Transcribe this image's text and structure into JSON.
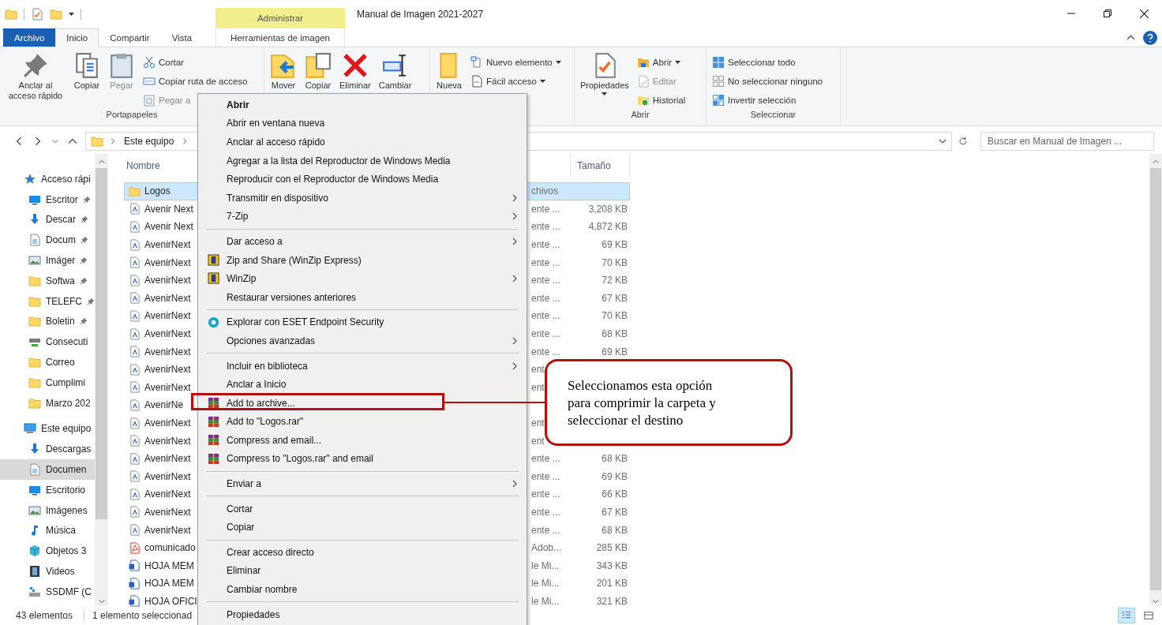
{
  "window": {
    "title": "Manual de Imagen 2021-2027"
  },
  "ribbon_tabs": [
    {
      "label": "Archivo",
      "kind": "file",
      "selected": false
    },
    {
      "label": "Inicio",
      "kind": "tab",
      "selected": true
    },
    {
      "label": "Compartir",
      "kind": "tab",
      "selected": false
    },
    {
      "label": "Vista",
      "kind": "tab",
      "selected": false
    },
    {
      "label": "Herramientas de imagen",
      "kind": "context",
      "header": "Administrar",
      "selected": false
    }
  ],
  "ribbon": {
    "groups": [
      {
        "label": "Portapapeles",
        "large": [
          {
            "label": "Anclar al acceso rápido",
            "kind": "pin",
            "disabled": false,
            "dropdown": false
          },
          {
            "label": "Copiar",
            "kind": "copy",
            "disabled": false,
            "dropdown": false
          },
          {
            "label": "Pegar",
            "kind": "paste",
            "disabled": true,
            "dropdown": false
          }
        ],
        "small": [
          {
            "label": "Cortar",
            "kind": "cut",
            "disabled": false,
            "dropdown": false
          },
          {
            "label": "Copiar ruta de acceso",
            "kind": "path",
            "disabled": false,
            "dropdown": false
          },
          {
            "label": "Pegar a",
            "kind": "paste-shortcut",
            "disabled": true,
            "dropdown": false
          }
        ]
      },
      {
        "large": [
          {
            "label": "Mover",
            "kind": "move",
            "disabled": false,
            "dropdown": false
          },
          {
            "label": "Copiar",
            "kind": "copy-to",
            "disabled": false,
            "dropdown": false
          },
          {
            "label": "Eliminar",
            "kind": "delete",
            "disabled": false,
            "dropdown": false
          },
          {
            "label": "Cambiar",
            "kind": "rename",
            "disabled": false,
            "dropdown": false
          }
        ]
      },
      {
        "large": [
          {
            "label": "Nueva",
            "kind": "new-folder",
            "disabled": false,
            "dropdown": false
          }
        ],
        "small": [
          {
            "label": "Nuevo elemento",
            "kind": "new-item",
            "disabled": false,
            "dropdown": true
          },
          {
            "label": "Fácil acceso",
            "kind": "easy-access",
            "disabled": false,
            "dropdown": true
          }
        ]
      },
      {
        "label": "Abrir",
        "large": [
          {
            "label": "Propiedades",
            "kind": "properties",
            "disabled": false,
            "dropdown": true
          }
        ],
        "small": [
          {
            "label": "Abrir",
            "kind": "open",
            "disabled": false,
            "dropdown": true
          },
          {
            "label": "Editar",
            "kind": "edit",
            "disabled": true,
            "dropdown": false
          },
          {
            "label": "Historial",
            "kind": "history",
            "disabled": false,
            "dropdown": false
          }
        ]
      },
      {
        "label": "Seleccionar",
        "small": [
          {
            "label": "Seleccionar todo",
            "kind": "select-all",
            "disabled": false,
            "dropdown": false
          },
          {
            "label": "No seleccionar ninguno",
            "kind": "select-none",
            "disabled": false,
            "dropdown": false
          },
          {
            "label": "Invertir selección",
            "kind": "invert",
            "disabled": false,
            "dropdown": false
          }
        ]
      }
    ]
  },
  "address": {
    "path": [
      "Este equipo"
    ],
    "search_placeholder": "Buscar en Manual de Imagen ..."
  },
  "navigation": [
    {
      "label": "Acceso rápi",
      "kind": "star",
      "selected": false,
      "children": [
        {
          "label": "Escritor",
          "kind": "desktop",
          "pinned": true,
          "selected": false
        },
        {
          "label": "Descar",
          "kind": "download",
          "pinned": true,
          "selected": false
        },
        {
          "label": "Docum",
          "kind": "document",
          "pinned": true,
          "selected": false
        },
        {
          "label": "Imáger",
          "kind": "pictures",
          "pinned": true,
          "selected": false
        },
        {
          "label": "Softwa",
          "kind": "folder",
          "pinned": true,
          "selected": false
        },
        {
          "label": "TELEFC",
          "kind": "folder",
          "pinned": true,
          "selected": false
        },
        {
          "label": "Boletin",
          "kind": "folder",
          "pinned": true,
          "selected": false
        },
        {
          "label": "Consecuti",
          "kind": "network",
          "selected": false
        },
        {
          "label": "Correo",
          "kind": "folder",
          "selected": false
        },
        {
          "label": "Cumplimi",
          "kind": "folder",
          "selected": false
        },
        {
          "label": "Marzo 202",
          "kind": "folder",
          "selected": false
        }
      ]
    },
    {
      "label": "Este equipo",
      "kind": "pc",
      "selected": false,
      "children": [
        {
          "label": "Descargas",
          "kind": "download",
          "selected": false
        },
        {
          "label": "Documen",
          "kind": "document",
          "selected": true
        },
        {
          "label": "Escritorio",
          "kind": "desktop",
          "selected": false
        },
        {
          "label": "Imágenes",
          "kind": "pictures",
          "selected": false
        },
        {
          "label": "Música",
          "kind": "music",
          "selected": false
        },
        {
          "label": "Objetos 3",
          "kind": "cube",
          "selected": false
        },
        {
          "label": "Videos",
          "kind": "video",
          "selected": false
        },
        {
          "label": "SSDMF (C",
          "kind": "drive",
          "selected": false
        }
      ]
    }
  ],
  "files": {
    "columns": {
      "name": "Nombre",
      "size": "Tamaño"
    },
    "rows": [
      {
        "kind": "folder",
        "name": "Logos",
        "type": "chivos",
        "selected": true
      },
      {
        "kind": "font",
        "name": "Avenir Next",
        "type": "ente ...",
        "size": "3,208 KB",
        "selected": false
      },
      {
        "kind": "font",
        "name": "Avenir Next",
        "type": "ente ...",
        "size": "4,872 KB",
        "selected": false
      },
      {
        "kind": "font",
        "name": "AvenirNext",
        "type": "ente ...",
        "size": "69 KB",
        "selected": false
      },
      {
        "kind": "font",
        "name": "AvenirNext",
        "type": "ente ...",
        "size": "70 KB",
        "selected": false
      },
      {
        "kind": "font",
        "name": "AvenirNext",
        "type": "ente ...",
        "size": "72 KB",
        "selected": false
      },
      {
        "kind": "font",
        "name": "AvenirNext",
        "type": "ente ...",
        "size": "67 KB",
        "selected": false
      },
      {
        "kind": "font",
        "name": "AvenirNext",
        "type": "ente ...",
        "size": "70 KB",
        "selected": false
      },
      {
        "kind": "font",
        "name": "AvenirNext",
        "type": "ente ...",
        "size": "68 KB",
        "selected": false
      },
      {
        "kind": "font",
        "name": "AvenirNext",
        "type": "ente ...",
        "size": "69 KB",
        "selected": false
      },
      {
        "kind": "font",
        "name": "AvenirNext",
        "type": "ent",
        "selected": false
      },
      {
        "kind": "font",
        "name": "AvenirNext",
        "type": "ent",
        "selected": false
      },
      {
        "kind": "font",
        "name": "AvenirNe",
        "selected": false
      },
      {
        "kind": "font",
        "name": "AvenirNext",
        "type": "ent",
        "selected": false
      },
      {
        "kind": "font",
        "name": "AvenirNext",
        "type": "ent",
        "selected": false
      },
      {
        "kind": "font",
        "name": "AvenirNext",
        "type": "ente ...",
        "size": "68 KB",
        "selected": false
      },
      {
        "kind": "font",
        "name": "AvenirNext",
        "type": "ente ...",
        "size": "69 KB",
        "selected": false
      },
      {
        "kind": "font",
        "name": "AvenirNext",
        "type": "ente ...",
        "size": "66 KB",
        "selected": false
      },
      {
        "kind": "font",
        "name": "AvenirNext",
        "type": "ente ...",
        "size": "67 KB",
        "selected": false
      },
      {
        "kind": "font",
        "name": "AvenirNext",
        "type": "ente ...",
        "size": "68 KB",
        "selected": false
      },
      {
        "kind": "pdf",
        "name": "comunicado",
        "type": "Adob...",
        "size": "285 KB",
        "selected": false
      },
      {
        "kind": "word",
        "name": "HOJA MEM",
        "type": "le Mi...",
        "size": "343 KB",
        "selected": false
      },
      {
        "kind": "word",
        "name": "HOJA MEM",
        "type": "le Mi...",
        "size": "201 KB",
        "selected": false
      },
      {
        "kind": "word",
        "name": "HOJA OFICI",
        "type": "le Mi...",
        "size": "321 KB",
        "selected": false
      }
    ]
  },
  "status_bar": {
    "count": "43 elementos",
    "selection": "1 elemento seleccionad"
  },
  "context_menu": {
    "groups": [
      [
        {
          "label": "Abrir",
          "kind": "default",
          "submenu": false,
          "annotated": false
        },
        {
          "label": "Abrir en ventana nueva",
          "kind": "plain",
          "submenu": false,
          "annotated": false
        },
        {
          "label": "Anclar al acceso rápido",
          "kind": "plain",
          "submenu": false,
          "annotated": false
        },
        {
          "label": "Agregar a la lista del Reproductor de Windows Media",
          "kind": "plain",
          "submenu": false,
          "annotated": false
        },
        {
          "label": "Reproducir con el Reproductor de Windows Media",
          "kind": "plain",
          "submenu": false,
          "annotated": false
        },
        {
          "label": "Transmitir en dispositivo",
          "kind": "plain",
          "submenu": true,
          "annotated": false
        },
        {
          "label": "7-Zip",
          "kind": "plain",
          "submenu": true,
          "annotated": false
        }
      ],
      [
        {
          "label": "Dar acceso a",
          "kind": "plain",
          "submenu": true,
          "annotated": false
        },
        {
          "label": "Zip and Share (WinZip Express)",
          "kind": "winzip",
          "submenu": false,
          "annotated": false
        },
        {
          "label": "WinZip",
          "kind": "winzip",
          "submenu": true,
          "annotated": false
        },
        {
          "label": "Restaurar versiones anteriores",
          "kind": "plain",
          "submenu": false,
          "annotated": false
        }
      ],
      [
        {
          "label": "Explorar con ESET Endpoint Security",
          "kind": "eset",
          "submenu": false,
          "annotated": false
        },
        {
          "label": "Opciones avanzadas",
          "kind": "plain",
          "submenu": true,
          "annotated": false
        }
      ],
      [
        {
          "label": "Incluir en biblioteca",
          "kind": "plain",
          "submenu": true,
          "annotated": false
        },
        {
          "label": "Anclar a Inicio",
          "kind": "plain",
          "submenu": false,
          "annotated": false
        },
        {
          "label": "Add to archive...",
          "kind": "winrar",
          "submenu": false,
          "annotated": true
        },
        {
          "label": "Add to \"Logos.rar\"",
          "kind": "winrar",
          "submenu": false,
          "annotated": false
        },
        {
          "label": "Compress and email...",
          "kind": "winrar",
          "submenu": false,
          "annotated": false
        },
        {
          "label": "Compress to \"Logos.rar\" and email",
          "kind": "winrar",
          "submenu": false,
          "annotated": false
        }
      ],
      [
        {
          "label": "Enviar a",
          "kind": "plain",
          "submenu": true,
          "annotated": false
        }
      ],
      [
        {
          "label": "Cortar",
          "kind": "plain",
          "submenu": false,
          "annotated": false
        },
        {
          "label": "Copiar",
          "kind": "plain",
          "submenu": false,
          "annotated": false
        }
      ],
      [
        {
          "label": "Crear acceso directo",
          "kind": "plain",
          "submenu": false,
          "annotated": false
        },
        {
          "label": "Eliminar",
          "kind": "plain",
          "submenu": false,
          "annotated": false
        },
        {
          "label": "Cambiar nombre",
          "kind": "plain",
          "submenu": false,
          "annotated": false
        }
      ],
      [
        {
          "label": "Propiedades",
          "kind": "plain",
          "submenu": false,
          "annotated": false
        }
      ]
    ]
  },
  "callout": {
    "text": "Seleccionamos esta opción para comprimir la carpeta y seleccionar el destino"
  }
}
